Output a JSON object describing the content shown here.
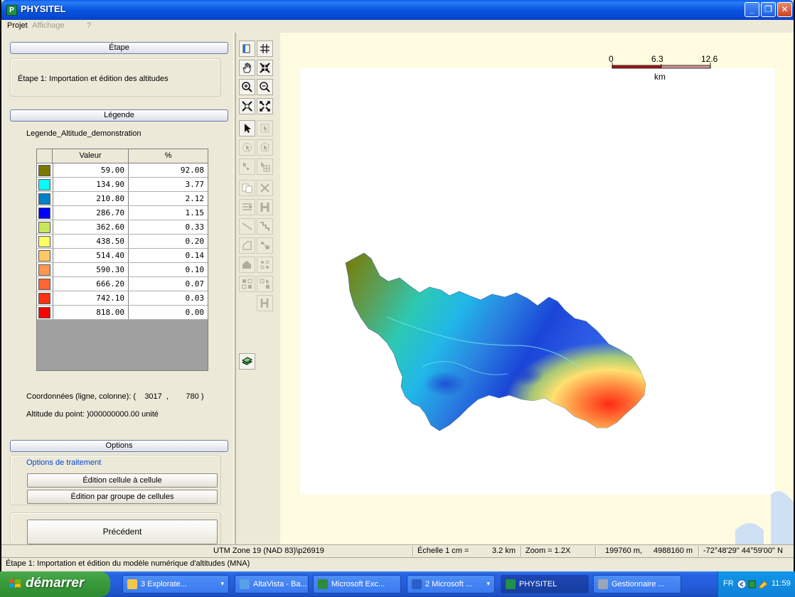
{
  "window": {
    "title": "PHYSITEL",
    "icon": "P",
    "controls": {
      "minimize": "_",
      "maximize": "❐",
      "close": "✕"
    }
  },
  "menu": [
    {
      "label": "Projet",
      "enabled": true
    },
    {
      "label": "Affichage",
      "enabled": false
    },
    {
      "label": "?",
      "enabled": false
    }
  ],
  "etape": {
    "header": "Étape",
    "text": "Étape 1: Importation et édition des altitudes"
  },
  "legende": {
    "header": "Légende",
    "name": "Legende_Altitude_demonstration",
    "columns": {
      "valeur": "Valeur",
      "percent": "%"
    },
    "rows": [
      {
        "value": "59.00",
        "percent": "92.08",
        "color": "#7a7a00"
      },
      {
        "value": "134.90",
        "percent": "3.77",
        "color": "#00ffff"
      },
      {
        "value": "210.80",
        "percent": "2.12",
        "color": "#0082c8"
      },
      {
        "value": "286.70",
        "percent": "1.15",
        "color": "#0000ff"
      },
      {
        "value": "362.60",
        "percent": "0.33",
        "color": "#c8e65a"
      },
      {
        "value": "438.50",
        "percent": "0.20",
        "color": "#ffff64"
      },
      {
        "value": "514.40",
        "percent": "0.14",
        "color": "#ffc864"
      },
      {
        "value": "590.30",
        "percent": "0.10",
        "color": "#ff9650"
      },
      {
        "value": "666.20",
        "percent": "0.07",
        "color": "#ff6432"
      },
      {
        "value": "742.10",
        "percent": "0.03",
        "color": "#ff3214"
      },
      {
        "value": "818.00",
        "percent": "0.00",
        "color": "#ff0000"
      }
    ],
    "coords_text": "Coordonnées (ligne, colonne): (    3017  ,        780 )",
    "altitude_text": "Altitude du point: )000000000.00   unité"
  },
  "options": {
    "header": "Options",
    "group_label": "Options de traitement",
    "buttons": [
      "Édition cellule à cellule",
      "Édition par groupe de cellules"
    ],
    "prev": "Précédent"
  },
  "map": {
    "scale": {
      "zero": "0",
      "mid": "6.3",
      "max": "12.6",
      "unit": "km"
    }
  },
  "status": {
    "projection": "UTM Zone 19 (NAD 83)\\p26919",
    "echelle": "Échelle 1 cm =",
    "echelle_value": "3.2 km",
    "zoom": "Zoom = 1.2X",
    "easting": "199760 m,",
    "northing": "4988160 m",
    "geo": "-72°48'29\" 44°59'00\" N",
    "message": "Étape 1: Importation et édition du modèle numérique d'altitudes (MNA)"
  },
  "taskbar": {
    "start": "démarrer",
    "items": [
      {
        "label": "3 Explorate...",
        "arrow": "▾",
        "icon_color": "#f3c84a",
        "active": false
      },
      {
        "label": "AltaVista - Ba...",
        "arrow": "",
        "icon_color": "#5aa0e8",
        "active": false
      },
      {
        "label": "Microsoft Exc...",
        "arrow": "",
        "icon_color": "#2f8a3c",
        "active": false
      },
      {
        "label": "2 Microsoft ...",
        "arrow": "▾",
        "icon_color": "#2b5fc8",
        "active": false
      },
      {
        "label": "PHYSITEL",
        "arrow": "",
        "icon_color": "#1f8f4a",
        "active": true
      },
      {
        "label": "Gestionnaire ...",
        "arrow": "",
        "icon_color": "#9aa6b8",
        "active": false
      }
    ],
    "lang": "FR",
    "clock": "11:59"
  }
}
